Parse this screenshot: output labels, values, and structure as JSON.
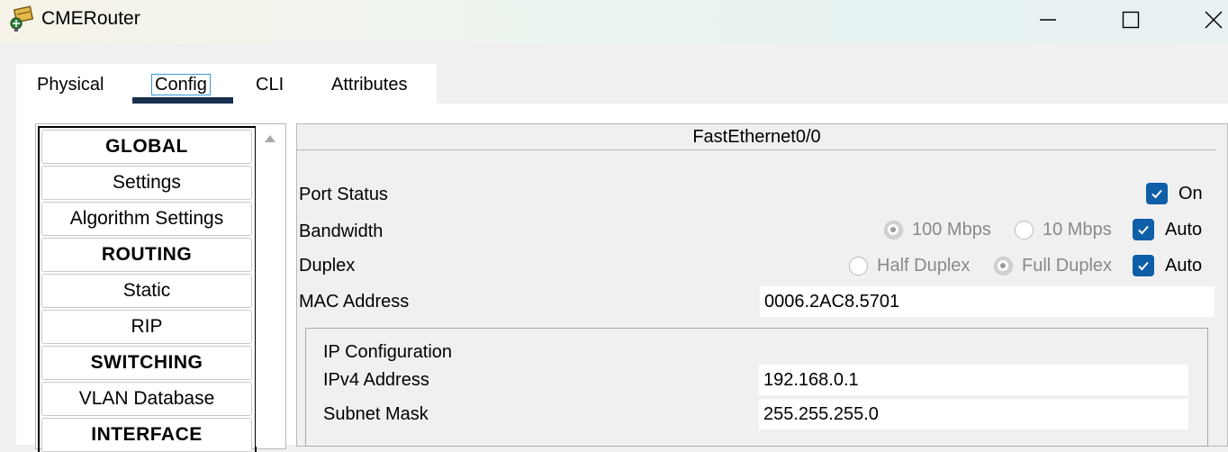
{
  "window": {
    "title": "CMERouter",
    "icon": "router-app-icon",
    "controls": [
      "minimize-icon",
      "maximize-icon",
      "close-icon"
    ]
  },
  "tabs": [
    {
      "label": "Physical",
      "active": false
    },
    {
      "label": "Config",
      "active": true
    },
    {
      "label": "CLI",
      "active": false
    },
    {
      "label": "Attributes",
      "active": false
    }
  ],
  "nav": {
    "items": [
      {
        "label": "GLOBAL",
        "type": "header"
      },
      {
        "label": "Settings",
        "type": "item"
      },
      {
        "label": "Algorithm Settings",
        "type": "item"
      },
      {
        "label": "ROUTING",
        "type": "header"
      },
      {
        "label": "Static",
        "type": "item"
      },
      {
        "label": "RIP",
        "type": "item"
      },
      {
        "label": "SWITCHING",
        "type": "header"
      },
      {
        "label": "VLAN Database",
        "type": "item"
      },
      {
        "label": "INTERFACE",
        "type": "header"
      }
    ]
  },
  "interface": {
    "title": "FastEthernet0/0",
    "port_status": {
      "label": "Port Status",
      "on_label": "On",
      "on": true
    },
    "bandwidth": {
      "label": "Bandwidth",
      "opt_100": "100 Mbps",
      "opt_10": "10 Mbps",
      "selected": "100 Mbps",
      "auto_label": "Auto",
      "auto": true
    },
    "duplex": {
      "label": "Duplex",
      "opt_half": "Half Duplex",
      "opt_full": "Full Duplex",
      "selected": "Full Duplex",
      "auto_label": "Auto",
      "auto": true
    },
    "mac": {
      "label": "MAC Address",
      "value": "0006.2AC8.5701"
    },
    "ip_config": {
      "title": "IP Configuration",
      "ipv4_label": "IPv4 Address",
      "ipv4_value": "192.168.0.1",
      "mask_label": "Subnet Mask",
      "mask_value": "255.255.255.0"
    }
  },
  "colors": {
    "checkbox": "#0f5ea8",
    "tab_underline": "#16304e",
    "focus_border": "#3a9ad9"
  }
}
